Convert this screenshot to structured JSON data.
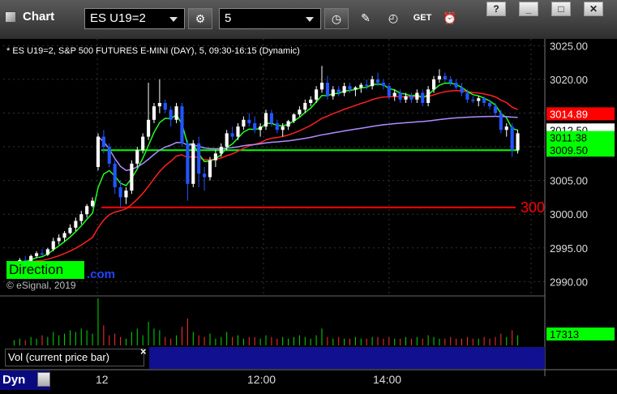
{
  "window": {
    "title": "Chart",
    "symbol_value": "ES U19=2",
    "interval_value": "5",
    "controls": {
      "help": "?",
      "minimize": "_",
      "maximize": "□",
      "close": "✕"
    },
    "toolbar_icons": [
      "gear-icon",
      "clock-icon",
      "pencil-icon",
      "study-icon",
      "get-icon",
      "alert-icon"
    ],
    "get_label": "GET"
  },
  "chart_data": {
    "type": "candlestick",
    "header": "* ES U19=2, S&P 500 FUTURES E-MINI (DAY), 5, 09:30-16:15 (Dynamic)",
    "copyright": "© eSignal, 2019",
    "overlay_text": "Direction",
    "overlay_suffix": ".com",
    "ylim": [
      2988,
      3026
    ],
    "y_ticks": [
      3025.0,
      3020.0,
      3015.0,
      3010.0,
      3005.0,
      3000.0,
      2995.0,
      2990.0
    ],
    "x_ticks": [
      "12",
      "12:00",
      "14:00"
    ],
    "levels": [
      {
        "value": 3001.0,
        "color": "#ff0000",
        "label": "300"
      },
      {
        "value": 3009.5,
        "color": "#00ff00"
      }
    ],
    "price_labels": [
      {
        "value": 3014.89,
        "bg": "#ff0000",
        "fg": "#ffffff"
      },
      {
        "value": 3012.5,
        "bg": "#ffffff",
        "fg": "#000000"
      },
      {
        "value": 3011.38,
        "bg": "#00ff00",
        "fg": "#000000"
      },
      {
        "value": 3009.5,
        "bg": "#00ff00",
        "fg": "#000000"
      }
    ],
    "candles": [
      [
        2992.5,
        2993.0,
        2992.0,
        2992.8
      ],
      [
        2992.8,
        2993.5,
        2992.5,
        2993.2
      ],
      [
        2993.2,
        2993.8,
        2992.8,
        2993.0
      ],
      [
        2993.0,
        2994.0,
        2992.8,
        2993.8
      ],
      [
        2993.8,
        2994.5,
        2993.5,
        2994.2
      ],
      [
        2994.2,
        2994.8,
        2993.8,
        2994.0
      ],
      [
        2994.0,
        2995.0,
        2993.8,
        2994.8
      ],
      [
        2994.8,
        2996.5,
        2994.5,
        2996.0
      ],
      [
        2996.0,
        2997.0,
        2995.5,
        2996.5
      ],
      [
        2996.5,
        2997.5,
        2996.0,
        2997.2
      ],
      [
        2997.2,
        2998.5,
        2997.0,
        2998.0
      ],
      [
        2998.0,
        2999.5,
        2997.5,
        2999.0
      ],
      [
        2999.0,
        3000.5,
        2998.5,
        3000.0
      ],
      [
        3000.0,
        3001.5,
        2999.5,
        3001.2
      ],
      [
        3001.2,
        3002.5,
        3001.0,
        3002.0
      ],
      [
        3007.0,
        3012.0,
        3006.5,
        3011.5
      ],
      [
        3011.5,
        3012.5,
        3009.0,
        3010.0
      ],
      [
        3010.0,
        3010.5,
        3007.0,
        3007.5
      ],
      [
        3007.5,
        3008.0,
        3003.0,
        3004.0
      ],
      [
        3004.0,
        3005.0,
        3001.0,
        3002.5
      ],
      [
        3002.5,
        3004.0,
        3001.5,
        3003.5
      ],
      [
        3003.5,
        3008.0,
        3003.0,
        3007.5
      ],
      [
        3007.5,
        3010.0,
        3007.0,
        3009.5
      ],
      [
        3009.5,
        3012.0,
        3009.0,
        3011.5
      ],
      [
        3011.5,
        3019.5,
        3011.0,
        3014.0
      ],
      [
        3014.0,
        3016.5,
        3013.5,
        3016.0
      ],
      [
        3016.0,
        3020.0,
        3015.0,
        3016.5
      ],
      [
        3016.5,
        3017.0,
        3015.0,
        3015.5
      ],
      [
        3015.5,
        3016.0,
        3013.0,
        3014.0
      ],
      [
        3014.0,
        3016.5,
        3013.5,
        3016.0
      ],
      [
        3016.0,
        3016.5,
        3010.0,
        3010.5
      ],
      [
        3010.5,
        3011.0,
        3002.0,
        3004.5
      ],
      [
        3004.5,
        3011.0,
        3004.0,
        3010.5
      ],
      [
        3010.5,
        3011.5,
        3004.0,
        3006.0
      ],
      [
        3006.0,
        3007.0,
        3003.5,
        3005.5
      ],
      [
        3005.5,
        3008.5,
        3005.0,
        3008.0
      ],
      [
        3008.0,
        3009.5,
        3007.0,
        3009.0
      ],
      [
        3009.0,
        3010.5,
        3008.5,
        3010.0
      ],
      [
        3010.0,
        3012.5,
        3009.5,
        3012.0
      ],
      [
        3012.0,
        3013.0,
        3011.0,
        3011.5
      ],
      [
        3011.5,
        3013.5,
        3011.0,
        3013.0
      ],
      [
        3013.0,
        3014.5,
        3012.5,
        3014.0
      ],
      [
        3014.0,
        3015.0,
        3013.0,
        3013.5
      ],
      [
        3013.5,
        3014.5,
        3012.0,
        3012.5
      ],
      [
        3012.5,
        3013.5,
        3011.5,
        3013.0
      ],
      [
        3013.0,
        3015.5,
        3012.5,
        3015.0
      ],
      [
        3015.0,
        3015.5,
        3013.0,
        3013.5
      ],
      [
        3013.5,
        3014.0,
        3012.0,
        3012.5
      ],
      [
        3012.5,
        3013.5,
        3011.5,
        3013.0
      ],
      [
        3013.0,
        3014.0,
        3012.5,
        3013.8
      ],
      [
        3013.8,
        3015.0,
        3013.5,
        3014.8
      ],
      [
        3014.8,
        3016.0,
        3014.5,
        3015.5
      ],
      [
        3015.5,
        3017.0,
        3015.0,
        3016.5
      ],
      [
        3016.5,
        3017.5,
        3016.0,
        3017.0
      ],
      [
        3017.0,
        3019.0,
        3016.5,
        3018.5
      ],
      [
        3018.5,
        3022.0,
        3018.0,
        3019.5
      ],
      [
        3019.5,
        3020.5,
        3017.0,
        3017.5
      ],
      [
        3017.5,
        3019.0,
        3017.0,
        3018.5
      ],
      [
        3018.5,
        3019.0,
        3017.5,
        3018.0
      ],
      [
        3018.0,
        3019.5,
        3017.5,
        3019.0
      ],
      [
        3019.0,
        3019.5,
        3018.0,
        3018.5
      ],
      [
        3018.5,
        3019.0,
        3017.5,
        3018.8
      ],
      [
        3018.8,
        3019.5,
        3018.0,
        3019.2
      ],
      [
        3019.2,
        3020.0,
        3018.5,
        3019.0
      ],
      [
        3019.0,
        3020.5,
        3018.5,
        3020.0
      ],
      [
        3020.0,
        3021.0,
        3019.0,
        3019.5
      ],
      [
        3019.5,
        3020.0,
        3018.5,
        3019.0
      ],
      [
        3019.0,
        3019.5,
        3017.0,
        3017.5
      ],
      [
        3017.5,
        3018.5,
        3016.8,
        3018.0
      ],
      [
        3018.0,
        3018.5,
        3016.5,
        3017.0
      ],
      [
        3017.0,
        3018.0,
        3016.5,
        3017.5
      ],
      [
        3017.5,
        3018.0,
        3016.5,
        3017.0
      ],
      [
        3017.0,
        3018.5,
        3016.5,
        3018.0
      ],
      [
        3018.0,
        3018.5,
        3016.0,
        3016.5
      ],
      [
        3016.5,
        3019.0,
        3016.0,
        3018.5
      ],
      [
        3018.5,
        3020.5,
        3018.0,
        3020.0
      ],
      [
        3020.0,
        3021.5,
        3019.5,
        3020.5
      ],
      [
        3020.5,
        3021.0,
        3019.5,
        3020.0
      ],
      [
        3020.0,
        3020.5,
        3019.0,
        3019.5
      ],
      [
        3019.5,
        3020.0,
        3018.5,
        3018.8
      ],
      [
        3018.8,
        3019.5,
        3017.5,
        3018.0
      ],
      [
        3018.0,
        3018.5,
        3016.5,
        3017.0
      ],
      [
        3017.0,
        3017.5,
        3016.5,
        3016.8
      ],
      [
        3016.8,
        3017.5,
        3016.0,
        3017.2
      ],
      [
        3017.2,
        3017.5,
        3016.0,
        3016.5
      ],
      [
        3016.5,
        3017.0,
        3015.5,
        3016.0
      ],
      [
        3016.0,
        3016.5,
        3014.5,
        3015.0
      ],
      [
        3015.0,
        3015.5,
        3012.0,
        3012.5
      ],
      [
        3012.5,
        3013.5,
        3011.5,
        3013.0
      ],
      [
        3013.0,
        3013.5,
        3008.5,
        3009.5
      ],
      [
        3009.5,
        3012.5,
        3009.0,
        3012.0
      ]
    ],
    "volume_panel": {
      "title": "Vol (current price bar)",
      "close_mark": "×",
      "value_label": "17313",
      "bars": [
        3,
        4,
        3,
        5,
        4,
        6,
        5,
        8,
        6,
        7,
        9,
        8,
        10,
        9,
        7,
        28,
        12,
        6,
        7,
        5,
        4,
        8,
        10,
        6,
        14,
        10,
        9,
        5,
        4,
        6,
        11,
        16,
        8,
        6,
        5,
        7,
        4,
        5,
        8,
        5,
        6,
        4,
        5,
        5,
        4,
        6,
        5,
        4,
        5,
        4,
        5,
        6,
        5,
        4,
        6,
        10,
        5,
        4,
        5,
        4,
        4,
        5,
        4,
        4,
        5,
        5,
        4,
        5,
        4,
        4,
        5,
        4,
        5,
        4,
        6,
        5,
        4,
        4,
        5,
        4,
        4,
        5,
        4,
        4,
        5,
        4,
        5,
        7,
        5,
        9,
        6
      ]
    },
    "time_axis": {
      "left_label": "Dyn"
    }
  }
}
